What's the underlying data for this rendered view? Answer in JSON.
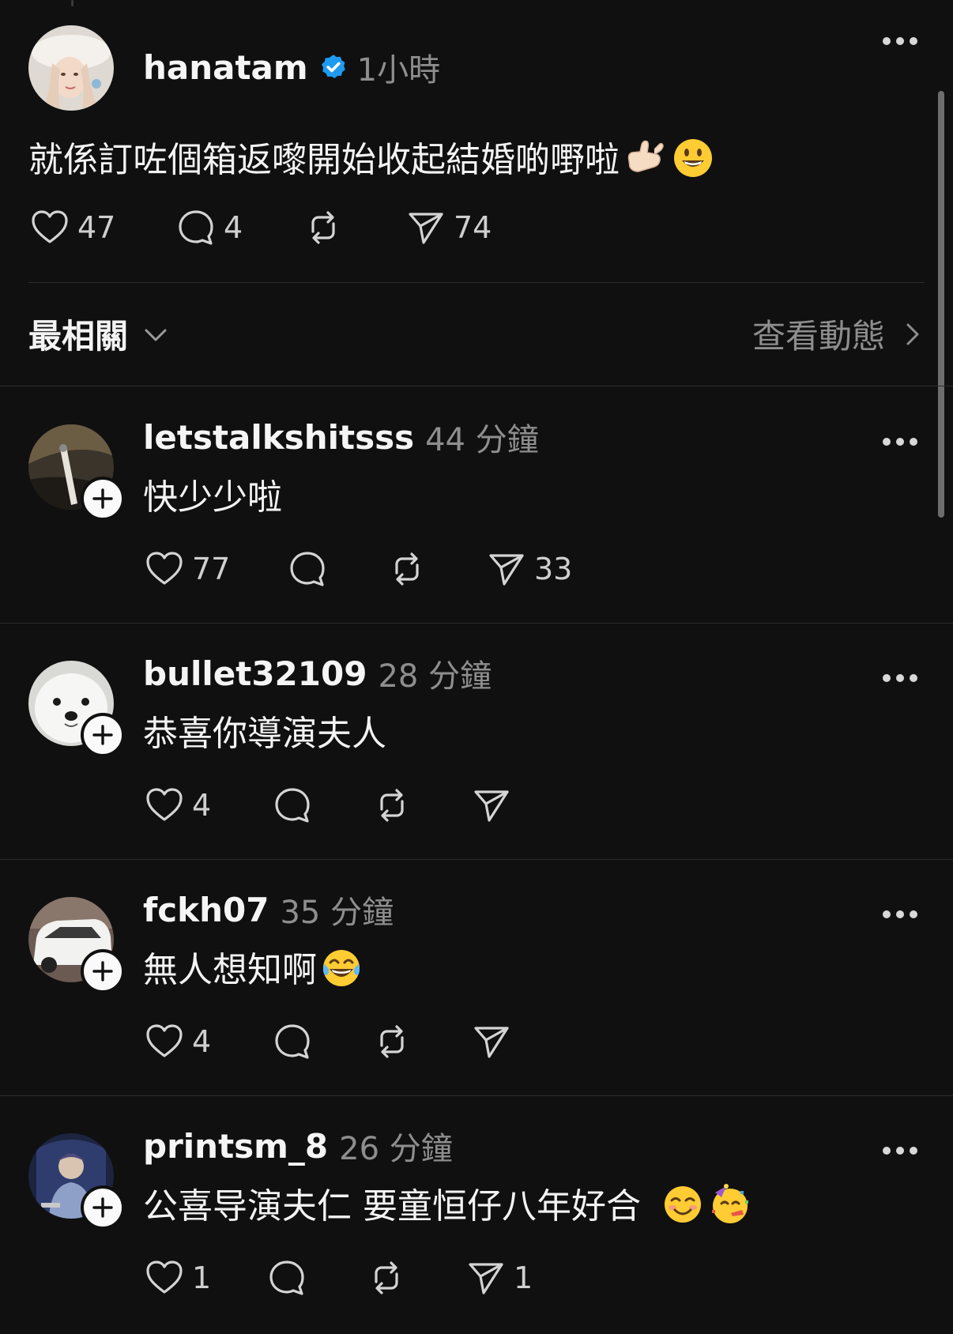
{
  "main_post": {
    "username": "hanatam",
    "time": "1小時",
    "text": "就係訂咗個箱返嚟開始收起結婚啲嘢啦",
    "emojis": [
      "call-me-hand-emoji",
      "smiley-emoji"
    ],
    "likes": "47",
    "replies": "4",
    "reposts": "",
    "shares": "74"
  },
  "filter": {
    "sort_label": "最相關",
    "view_activity": "查看動態"
  },
  "comments": [
    {
      "username": "letstalkshitsss",
      "time": "44 分鐘",
      "text": "快少少啦",
      "likes": "77",
      "replies": "",
      "reposts": "",
      "shares": "33",
      "emojis": []
    },
    {
      "username": "bullet32109",
      "time": "28 分鐘",
      "text": "恭喜你導演夫人",
      "likes": "4",
      "replies": "",
      "reposts": "",
      "shares": "",
      "emojis": []
    },
    {
      "username": "fckh07",
      "time": "35 分鐘",
      "text": "無人想知啊",
      "likes": "4",
      "replies": "",
      "reposts": "",
      "shares": "",
      "emojis": [
        "tears-of-joy-emoji"
      ]
    },
    {
      "username": "printsm_8",
      "time": "26 分鐘",
      "text": "公喜导演夫仁 要童恒仔八年好合 ",
      "likes": "1",
      "replies": "",
      "reposts": "",
      "shares": "1",
      "emojis": [
        "blush-emoji",
        "partying-face-emoji"
      ]
    }
  ],
  "colors": {
    "background": "#101010",
    "text": "#f3f3f3",
    "muted": "#8e8e8e",
    "verified": "#1d9bf0"
  }
}
